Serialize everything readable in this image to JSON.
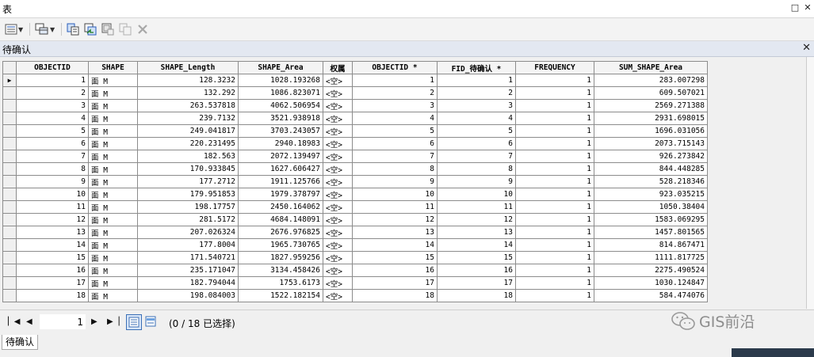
{
  "window": {
    "title": "表"
  },
  "table_tab": {
    "name": "待确认"
  },
  "grid": {
    "columns": [
      "OBJECTID",
      "SHAPE",
      "SHAPE_Length",
      "SHAPE_Area",
      "权属",
      "OBJECTID *",
      "FID_待确认 *",
      "FREQUENCY",
      "SUM_SHAPE_Area"
    ],
    "rows": [
      [
        "1",
        "面 M",
        "128.3232",
        "1028.193268",
        "<空>",
        "1",
        "1",
        "1",
        "283.007298"
      ],
      [
        "2",
        "面 M",
        "132.292",
        "1086.823071",
        "<空>",
        "2",
        "2",
        "1",
        "609.507021"
      ],
      [
        "3",
        "面 M",
        "263.537818",
        "4062.506954",
        "<空>",
        "3",
        "3",
        "1",
        "2569.271388"
      ],
      [
        "4",
        "面 M",
        "239.7132",
        "3521.938918",
        "<空>",
        "4",
        "4",
        "1",
        "2931.698015"
      ],
      [
        "5",
        "面 M",
        "249.041817",
        "3703.243057",
        "<空>",
        "5",
        "5",
        "1",
        "1696.031056"
      ],
      [
        "6",
        "面 M",
        "220.231495",
        "2940.18983",
        "<空>",
        "6",
        "6",
        "1",
        "2073.715143"
      ],
      [
        "7",
        "面 M",
        "182.563",
        "2072.139497",
        "<空>",
        "7",
        "7",
        "1",
        "926.273842"
      ],
      [
        "8",
        "面 M",
        "170.933845",
        "1627.606427",
        "<空>",
        "8",
        "8",
        "1",
        "844.448285"
      ],
      [
        "9",
        "面 M",
        "177.2712",
        "1911.125766",
        "<空>",
        "9",
        "9",
        "1",
        "528.218346"
      ],
      [
        "10",
        "面 M",
        "179.951853",
        "1979.378797",
        "<空>",
        "10",
        "10",
        "1",
        "923.035215"
      ],
      [
        "11",
        "面 M",
        "198.17757",
        "2450.164062",
        "<空>",
        "11",
        "11",
        "1",
        "1050.38404"
      ],
      [
        "12",
        "面 M",
        "281.5172",
        "4684.148091",
        "<空>",
        "12",
        "12",
        "1",
        "1583.069295"
      ],
      [
        "13",
        "面 M",
        "207.026324",
        "2676.976825",
        "<空>",
        "13",
        "13",
        "1",
        "1457.801565"
      ],
      [
        "14",
        "面 M",
        "177.8004",
        "1965.730765",
        "<空>",
        "14",
        "14",
        "1",
        "814.867471"
      ],
      [
        "15",
        "面 M",
        "171.540721",
        "1827.959256",
        "<空>",
        "15",
        "15",
        "1",
        "1111.817725"
      ],
      [
        "16",
        "面 M",
        "235.171047",
        "3134.458426",
        "<空>",
        "16",
        "16",
        "1",
        "2275.490524"
      ],
      [
        "17",
        "面 M",
        "182.794044",
        "1753.6173",
        "<空>",
        "17",
        "17",
        "1",
        "1030.124847"
      ],
      [
        "18",
        "面 M",
        "198.084003",
        "1522.182154",
        "<空>",
        "18",
        "18",
        "1",
        "584.474076"
      ]
    ]
  },
  "statusbar": {
    "current_record": "1",
    "selection_info": "(0 / 18 已选择)"
  },
  "watermark": {
    "text": "GIS前沿"
  },
  "bottom_tabs": [
    {
      "label": "待确认"
    }
  ]
}
